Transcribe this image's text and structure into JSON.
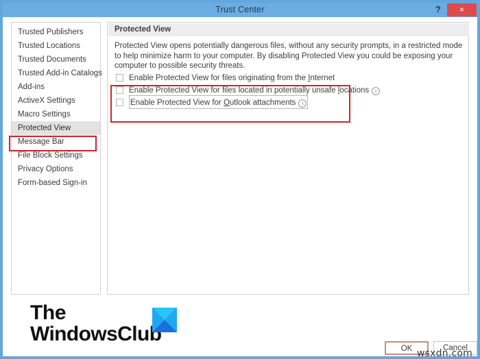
{
  "window": {
    "title": "Trust Center",
    "help_label": "?",
    "close_label": "×",
    "accent_color": "#6bace2",
    "close_color": "#dd4b4b"
  },
  "sidebar": {
    "items": [
      {
        "label": "Trusted Publishers",
        "selected": false
      },
      {
        "label": "Trusted Locations",
        "selected": false
      },
      {
        "label": "Trusted Documents",
        "selected": false
      },
      {
        "label": "Trusted Add-in Catalogs",
        "selected": false
      },
      {
        "label": "Add-ins",
        "selected": false
      },
      {
        "label": "ActiveX Settings",
        "selected": false
      },
      {
        "label": "Macro Settings",
        "selected": false
      },
      {
        "label": "Protected View",
        "selected": true
      },
      {
        "label": "Message Bar",
        "selected": false
      },
      {
        "label": "File Block Settings",
        "selected": false
      },
      {
        "label": "Privacy Options",
        "selected": false
      },
      {
        "label": "Form-based Sign-in",
        "selected": false
      }
    ]
  },
  "panel": {
    "section_header": "Protected View",
    "description": "Protected View opens potentially dangerous files, without any security prompts, in a restricted mode to help minimize harm to your computer. By disabling Protected View you could be exposing your computer to possible security threats.",
    "options": [
      {
        "label_before": "Enable Protected View for files originating from the ",
        "accel": "I",
        "label_after": "nternet",
        "checked": false,
        "has_info": false,
        "focused": false
      },
      {
        "label_before": "Enable Protected View for files located in potentially unsafe ",
        "accel": "l",
        "label_after": "ocations",
        "checked": false,
        "has_info": true,
        "focused": false
      },
      {
        "label_before": "Enable Protected View for ",
        "accel": "O",
        "label_after": "utlook attachments",
        "checked": false,
        "has_info": true,
        "focused": true
      }
    ],
    "info_icon_glyph": "i"
  },
  "footer": {
    "ok_label": "OK",
    "cancel_label": "Cancel"
  },
  "annotations": {
    "color": "#d81f26",
    "sidebar_target": "Protected View",
    "options_target": "protected-view-checkbox-group"
  },
  "watermarks": {
    "logo_line1": "The",
    "logo_line2": "WindowsClub",
    "site": "wsxdn.com"
  }
}
